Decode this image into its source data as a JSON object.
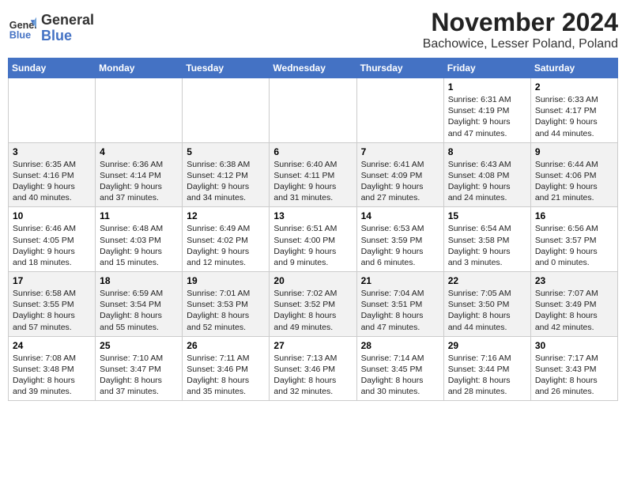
{
  "header": {
    "logo_line1": "General",
    "logo_line2": "Blue",
    "main_title": "November 2024",
    "subtitle": "Bachowice, Lesser Poland, Poland"
  },
  "weekdays": [
    "Sunday",
    "Monday",
    "Tuesday",
    "Wednesday",
    "Thursday",
    "Friday",
    "Saturday"
  ],
  "weeks": [
    [
      {
        "day": null
      },
      {
        "day": null
      },
      {
        "day": null
      },
      {
        "day": null
      },
      {
        "day": null
      },
      {
        "day": "1",
        "sunrise": "6:31 AM",
        "sunset": "4:19 PM",
        "daylight": "9 hours and 47 minutes."
      },
      {
        "day": "2",
        "sunrise": "6:33 AM",
        "sunset": "4:17 PM",
        "daylight": "9 hours and 44 minutes."
      }
    ],
    [
      {
        "day": "3",
        "sunrise": "6:35 AM",
        "sunset": "4:16 PM",
        "daylight": "9 hours and 40 minutes."
      },
      {
        "day": "4",
        "sunrise": "6:36 AM",
        "sunset": "4:14 PM",
        "daylight": "9 hours and 37 minutes."
      },
      {
        "day": "5",
        "sunrise": "6:38 AM",
        "sunset": "4:12 PM",
        "daylight": "9 hours and 34 minutes."
      },
      {
        "day": "6",
        "sunrise": "6:40 AM",
        "sunset": "4:11 PM",
        "daylight": "9 hours and 31 minutes."
      },
      {
        "day": "7",
        "sunrise": "6:41 AM",
        "sunset": "4:09 PM",
        "daylight": "9 hours and 27 minutes."
      },
      {
        "day": "8",
        "sunrise": "6:43 AM",
        "sunset": "4:08 PM",
        "daylight": "9 hours and 24 minutes."
      },
      {
        "day": "9",
        "sunrise": "6:44 AM",
        "sunset": "4:06 PM",
        "daylight": "9 hours and 21 minutes."
      }
    ],
    [
      {
        "day": "10",
        "sunrise": "6:46 AM",
        "sunset": "4:05 PM",
        "daylight": "9 hours and 18 minutes."
      },
      {
        "day": "11",
        "sunrise": "6:48 AM",
        "sunset": "4:03 PM",
        "daylight": "9 hours and 15 minutes."
      },
      {
        "day": "12",
        "sunrise": "6:49 AM",
        "sunset": "4:02 PM",
        "daylight": "9 hours and 12 minutes."
      },
      {
        "day": "13",
        "sunrise": "6:51 AM",
        "sunset": "4:00 PM",
        "daylight": "9 hours and 9 minutes."
      },
      {
        "day": "14",
        "sunrise": "6:53 AM",
        "sunset": "3:59 PM",
        "daylight": "9 hours and 6 minutes."
      },
      {
        "day": "15",
        "sunrise": "6:54 AM",
        "sunset": "3:58 PM",
        "daylight": "9 hours and 3 minutes."
      },
      {
        "day": "16",
        "sunrise": "6:56 AM",
        "sunset": "3:57 PM",
        "daylight": "9 hours and 0 minutes."
      }
    ],
    [
      {
        "day": "17",
        "sunrise": "6:58 AM",
        "sunset": "3:55 PM",
        "daylight": "8 hours and 57 minutes."
      },
      {
        "day": "18",
        "sunrise": "6:59 AM",
        "sunset": "3:54 PM",
        "daylight": "8 hours and 55 minutes."
      },
      {
        "day": "19",
        "sunrise": "7:01 AM",
        "sunset": "3:53 PM",
        "daylight": "8 hours and 52 minutes."
      },
      {
        "day": "20",
        "sunrise": "7:02 AM",
        "sunset": "3:52 PM",
        "daylight": "8 hours and 49 minutes."
      },
      {
        "day": "21",
        "sunrise": "7:04 AM",
        "sunset": "3:51 PM",
        "daylight": "8 hours and 47 minutes."
      },
      {
        "day": "22",
        "sunrise": "7:05 AM",
        "sunset": "3:50 PM",
        "daylight": "8 hours and 44 minutes."
      },
      {
        "day": "23",
        "sunrise": "7:07 AM",
        "sunset": "3:49 PM",
        "daylight": "8 hours and 42 minutes."
      }
    ],
    [
      {
        "day": "24",
        "sunrise": "7:08 AM",
        "sunset": "3:48 PM",
        "daylight": "8 hours and 39 minutes."
      },
      {
        "day": "25",
        "sunrise": "7:10 AM",
        "sunset": "3:47 PM",
        "daylight": "8 hours and 37 minutes."
      },
      {
        "day": "26",
        "sunrise": "7:11 AM",
        "sunset": "3:46 PM",
        "daylight": "8 hours and 35 minutes."
      },
      {
        "day": "27",
        "sunrise": "7:13 AM",
        "sunset": "3:46 PM",
        "daylight": "8 hours and 32 minutes."
      },
      {
        "day": "28",
        "sunrise": "7:14 AM",
        "sunset": "3:45 PM",
        "daylight": "8 hours and 30 minutes."
      },
      {
        "day": "29",
        "sunrise": "7:16 AM",
        "sunset": "3:44 PM",
        "daylight": "8 hours and 28 minutes."
      },
      {
        "day": "30",
        "sunrise": "7:17 AM",
        "sunset": "3:43 PM",
        "daylight": "8 hours and 26 minutes."
      }
    ]
  ],
  "labels": {
    "sunrise": "Sunrise:",
    "sunset": "Sunset:",
    "daylight": "Daylight:"
  }
}
